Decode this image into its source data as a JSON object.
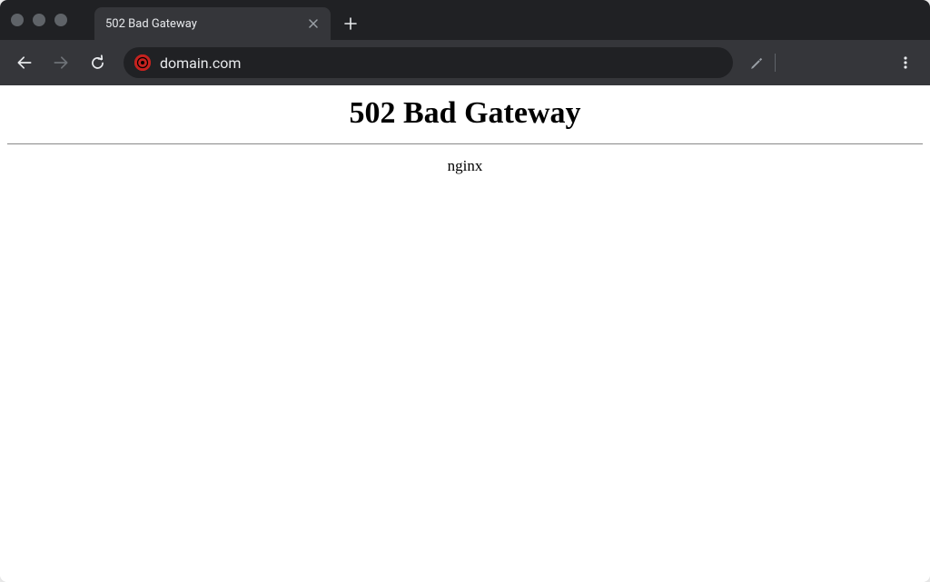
{
  "tab": {
    "title": "502 Bad Gateway"
  },
  "address": {
    "url": "domain.com"
  },
  "page": {
    "heading": "502 Bad Gateway",
    "server": "nginx"
  }
}
